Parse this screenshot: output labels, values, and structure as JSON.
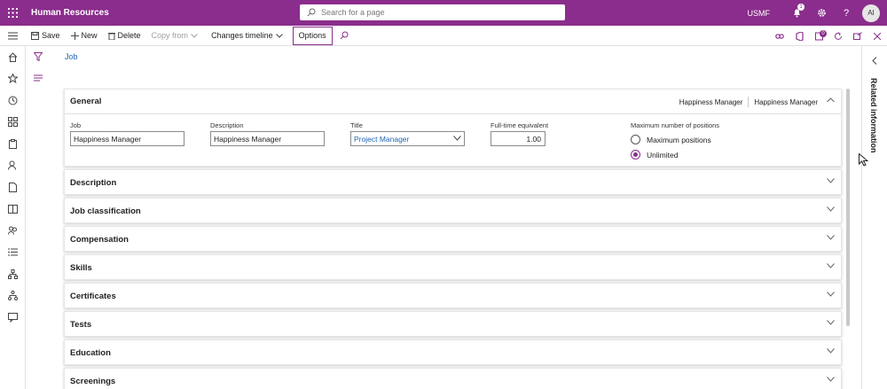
{
  "app": {
    "title": "Human Resources",
    "company": "USMF",
    "avatar": "AI",
    "notification_count": "1"
  },
  "search": {
    "placeholder": "Search for a page"
  },
  "toolbar": {
    "save": "Save",
    "new": "New",
    "delete": "Delete",
    "copy_from": "Copy from",
    "changes_timeline": "Changes timeline",
    "options": "Options",
    "attachments_count": "0"
  },
  "breadcrumb": "Job",
  "general": {
    "title": "General",
    "summary1": "Happiness Manager",
    "summary2": "Happiness Manager",
    "job_label": "Job",
    "job_value": "Happiness Manager",
    "description_label": "Description",
    "description_value": "Happiness Manager",
    "title_label": "Title",
    "title_value": "Project Manager",
    "fte_label": "Full-time equivalent",
    "fte_value": "1.00",
    "max_positions_label": "Maximum number of positions",
    "radio_max": "Maximum positions",
    "radio_unlimited": "Unlimited",
    "selected": "Unlimited"
  },
  "sections": [
    "Description",
    "Job classification",
    "Compensation",
    "Skills",
    "Certificates",
    "Tests",
    "Education",
    "Screenings"
  ],
  "right_panel": {
    "title": "Related information"
  },
  "colors": {
    "brand": "#8a2d8c",
    "link": "#2266b3"
  }
}
